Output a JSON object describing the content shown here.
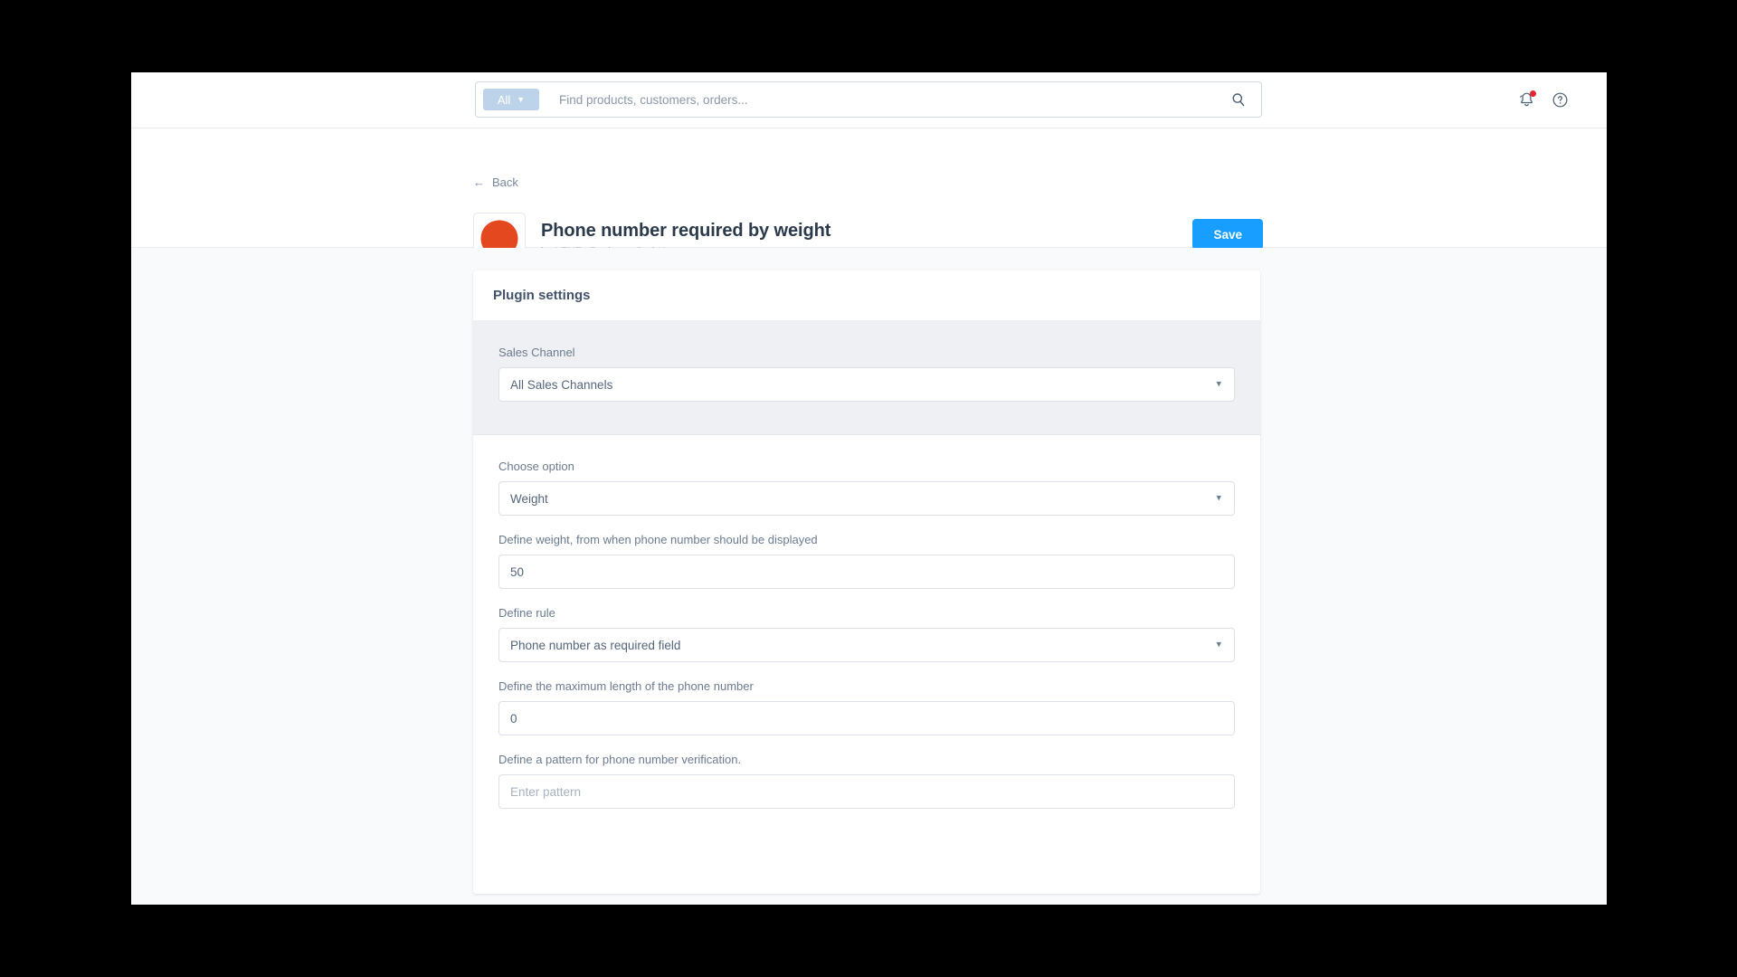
{
  "topbar": {
    "scope_filter_label": "All",
    "scope_filter_icon": "chevron-down-icon",
    "search_placeholder": "Find products, customers, orders...",
    "search_value": "",
    "search_icon": "search-icon",
    "notifications_icon": "bell-icon",
    "has_notification": true,
    "help_icon": "question-circle-icon"
  },
  "plugin_header": {
    "back_label": "Back",
    "back_icon": "arrow-left-icon",
    "logo_icon": "plugin-logo",
    "logo_color": "#e3481f",
    "title": "Phone number required by weight",
    "author": "by LENZ eBusiness GmbH",
    "save_label": "Save"
  },
  "card": {
    "header_title": "Plugin settings",
    "sales_channel": {
      "label": "Sales Channel",
      "value": "All Sales Channels",
      "chevron": "chevron-down-icon"
    },
    "fields": [
      {
        "name": "choose-option",
        "label": "Choose option",
        "type": "select",
        "value": "Weight",
        "chevron": "chevron-down-icon"
      },
      {
        "name": "define-weight",
        "label": "Define weight, from when phone number should be displayed",
        "type": "input",
        "value": "50",
        "placeholder": ""
      },
      {
        "name": "define-rule",
        "label": "Define rule",
        "type": "select",
        "value": "Phone number as required field",
        "chevron": "chevron-down-icon"
      },
      {
        "name": "max-length",
        "label": "Define the maximum length of the phone number",
        "type": "input",
        "value": "0",
        "placeholder": ""
      },
      {
        "name": "pattern",
        "label": "Define a pattern for phone number verification.",
        "type": "input",
        "value": "",
        "placeholder": "Enter pattern"
      }
    ]
  },
  "colors": {
    "accent": "#189eff",
    "notification": "#e3262f",
    "logo": "#e3481f",
    "text_dark": "#2b3a4a",
    "text_muted": "#6b7b8f"
  }
}
